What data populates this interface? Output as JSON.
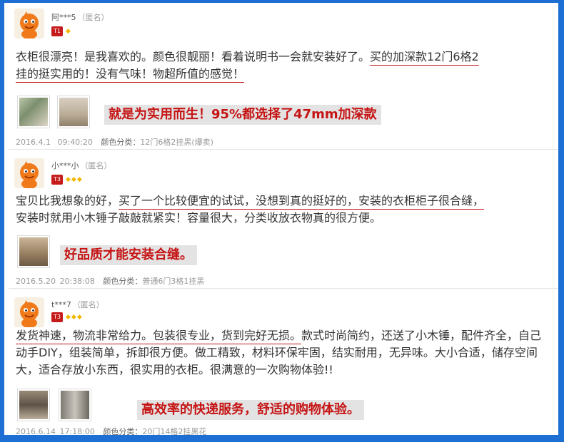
{
  "reviews": [
    {
      "username": "阿***5",
      "anon": "（匿名）",
      "level": "T1",
      "diamonds": "◆",
      "comment_pre": "衣柜很漂亮！是我喜欢的。颜色很靓丽！看着说明书一会就安装好了。",
      "comment_ul1": "买的加深款12门6格2",
      "comment_ul2": "挂的挺实用的！没有气味！物超所值的感觉！",
      "comment_post": "",
      "tagline": "就是为实用而生！95%都选择了47mm加深款",
      "date": "2016.4.1",
      "time": "09:40:20",
      "category_label": "颜色分类：",
      "category_value": "12门6格2挂黑(爆卖)"
    },
    {
      "username": "小***小",
      "anon": "（匿名）",
      "level": "T3",
      "diamonds": "◆◆◆",
      "comment_pre": "宝贝比我想象的好，",
      "comment_ul1": "买了一个比较便宜的试试，没想到真的挺好的，安装的衣柜柜子很合缝，",
      "comment_post": "安装时就用小木锤子敲敲就紧实！容量很大，分类收放衣物真的很方便。",
      "tagline": "好品质才能安装合缝。",
      "date": "2016.5.20",
      "time": "20:38:08",
      "category_label": "颜色分类：",
      "category_value": "普通6门3格1挂黑"
    },
    {
      "username": "t***7",
      "anon": "（匿名）",
      "level": "T3",
      "diamonds": "◆◆◆",
      "comment_ul1": "发货神速，物流非常给力。包装很专业，货到完好无损。",
      "comment_post": "款式时尚简约，还送了小木锤，配件齐全，自己动手DIY，组装简单，拆卸很方便。做工精致，材料环保牢固，结实耐用，无异味。大小合适，储存空间大，适合存放小东西，很实用的衣柜。很满意的一次购物体验!!",
      "tagline": "高效率的快递服务，舒适的购物体验。",
      "date": "2016.6.14",
      "time": "17:18:00",
      "category_label": "颜色分类：",
      "category_value": "20门14格2挂黑花"
    }
  ],
  "colors": {
    "frame": "#1e6fd4",
    "accent_red": "#c41a1a",
    "tag_bg": "#e3e3e3"
  },
  "icons": [
    "avatar-mascot-icon",
    "level-badge-icon",
    "diamond-icon"
  ]
}
